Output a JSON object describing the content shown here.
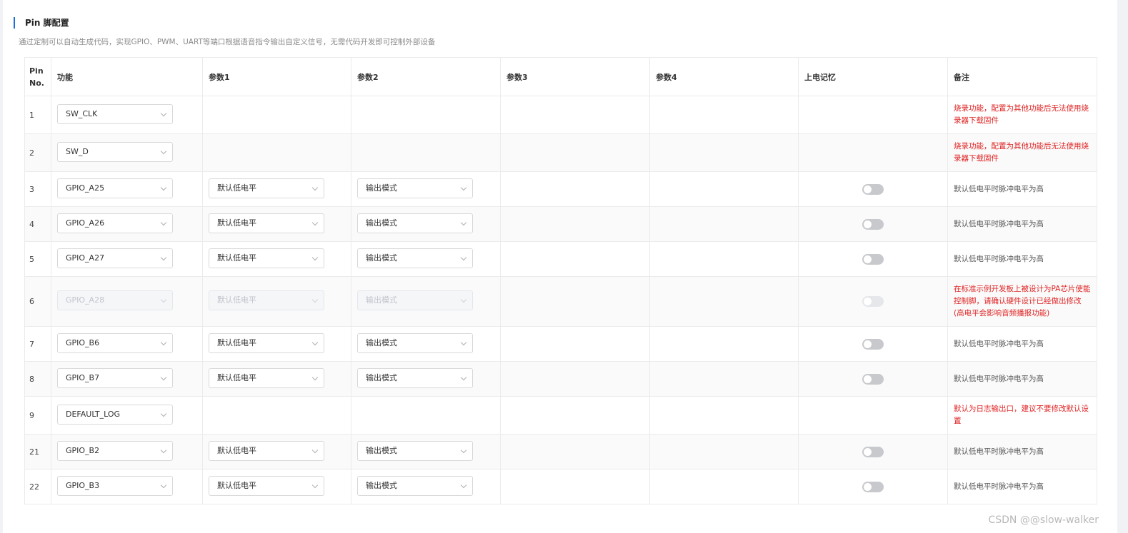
{
  "section": {
    "title": "Pin 脚配置",
    "description": "通过定制可以自动生成代码，实现GPIO、PWM、UART等端口根据语音指令输出自定义信号，无需代码开发即可控制外部设备"
  },
  "table": {
    "headers": {
      "pin": "Pin No.",
      "function": "功能",
      "param1": "参数1",
      "param2": "参数2",
      "param3": "参数3",
      "param4": "参数4",
      "power_memory": "上电记忆",
      "note": "备注"
    },
    "rows": [
      {
        "pin": "1",
        "function": "SW_CLK",
        "param1": "",
        "param2": "",
        "toggle": false,
        "disabled": false,
        "note": "烧录功能，配置为其他功能后无法使用烧录器下载固件",
        "note_warn": true
      },
      {
        "pin": "2",
        "function": "SW_D",
        "param1": "",
        "param2": "",
        "toggle": false,
        "disabled": false,
        "note": "烧录功能，配置为其他功能后无法使用烧录器下载固件",
        "note_warn": true
      },
      {
        "pin": "3",
        "function": "GPIO_A25",
        "param1": "默认低电平",
        "param2": "输出模式",
        "toggle": true,
        "disabled": false,
        "note": "默认低电平时脉冲电平为高",
        "note_warn": false
      },
      {
        "pin": "4",
        "function": "GPIO_A26",
        "param1": "默认低电平",
        "param2": "输出模式",
        "toggle": true,
        "disabled": false,
        "note": "默认低电平时脉冲电平为高",
        "note_warn": false
      },
      {
        "pin": "5",
        "function": "GPIO_A27",
        "param1": "默认低电平",
        "param2": "输出模式",
        "toggle": true,
        "disabled": false,
        "note": "默认低电平时脉冲电平为高",
        "note_warn": false
      },
      {
        "pin": "6",
        "function": "GPIO_A28",
        "param1": "默认低电平",
        "param2": "输出模式",
        "toggle": true,
        "disabled": true,
        "note": "在标准示例开发板上被设计为PA芯片使能控制脚，请确认硬件设计已经做出修改(高电平会影响音频播报功能)",
        "note_warn": true
      },
      {
        "pin": "7",
        "function": "GPIO_B6",
        "param1": "默认低电平",
        "param2": "输出模式",
        "toggle": true,
        "disabled": false,
        "note": "默认低电平时脉冲电平为高",
        "note_warn": false
      },
      {
        "pin": "8",
        "function": "GPIO_B7",
        "param1": "默认低电平",
        "param2": "输出模式",
        "toggle": true,
        "disabled": false,
        "note": "默认低电平时脉冲电平为高",
        "note_warn": false
      },
      {
        "pin": "9",
        "function": "DEFAULT_LOG",
        "param1": "",
        "param2": "",
        "toggle": false,
        "disabled": false,
        "note": "默认为日志输出口，建议不要修改默认设置",
        "note_warn": true
      },
      {
        "pin": "21",
        "function": "GPIO_B2",
        "param1": "默认低电平",
        "param2": "输出模式",
        "toggle": true,
        "disabled": false,
        "note": "默认低电平时脉冲电平为高",
        "note_warn": false
      },
      {
        "pin": "22",
        "function": "GPIO_B3",
        "param1": "默认低电平",
        "param2": "输出模式",
        "toggle": true,
        "disabled": false,
        "note": "默认低电平时脉冲电平为高",
        "note_warn": false
      }
    ]
  },
  "watermark": "CSDN @@slow-walker",
  "colors": {
    "accent": "#1f6fd6",
    "warn": "#e02424",
    "toggle_off": "#c8c9cc"
  },
  "icons": {
    "select_arrow": "chevron-down-icon"
  }
}
